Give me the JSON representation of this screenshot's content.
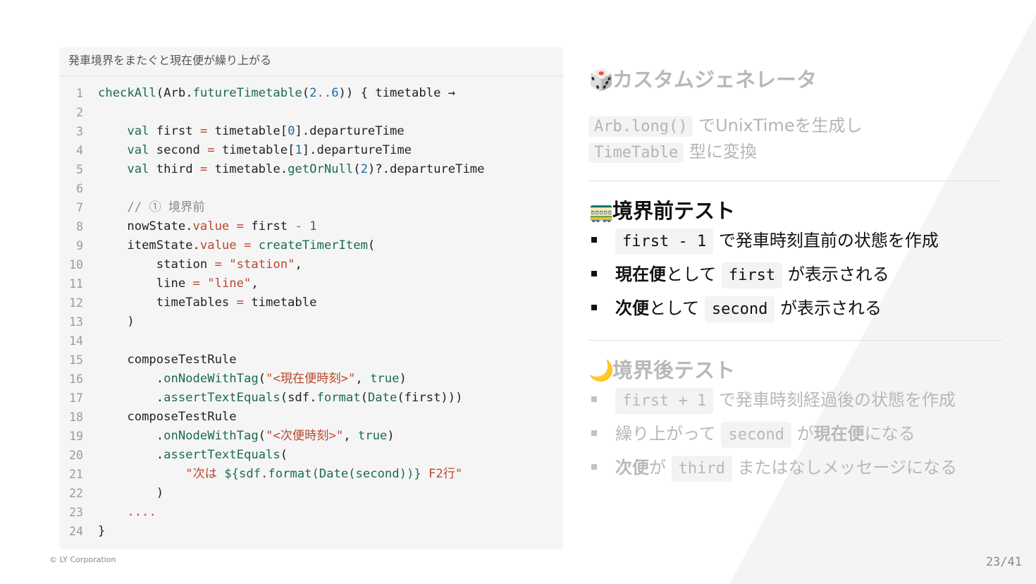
{
  "code_panel": {
    "title": "発車境界をまたぐと現在便が繰り上がる",
    "lines": [
      {
        "n": "1",
        "t": [
          [
            "fn",
            "checkAll"
          ],
          [
            "",
            "(Arb."
          ],
          [
            "fn",
            "futureTimetable"
          ],
          [
            "",
            "("
          ],
          [
            "num",
            "2"
          ],
          [
            "dot",
            ".."
          ],
          [
            "num",
            "6"
          ],
          [
            "",
            "))"
          ],
          [
            "",
            " { timetable →"
          ]
        ]
      },
      {
        "n": "2",
        "t": []
      },
      {
        "n": "3",
        "t": [
          [
            "",
            "    "
          ],
          [
            "kw",
            "val"
          ],
          [
            "",
            " first "
          ],
          [
            "op",
            "="
          ],
          [
            "",
            " timetable["
          ],
          [
            "num",
            "0"
          ],
          [
            "",
            "].departureTime"
          ]
        ]
      },
      {
        "n": "4",
        "t": [
          [
            "",
            "    "
          ],
          [
            "kw",
            "val"
          ],
          [
            "",
            " second "
          ],
          [
            "op",
            "="
          ],
          [
            "",
            " timetable["
          ],
          [
            "num",
            "1"
          ],
          [
            "",
            "].departureTime"
          ]
        ]
      },
      {
        "n": "5",
        "t": [
          [
            "",
            "    "
          ],
          [
            "kw",
            "val"
          ],
          [
            "",
            " third "
          ],
          [
            "op",
            "="
          ],
          [
            "",
            " timetable."
          ],
          [
            "fn",
            "getOrNull"
          ],
          [
            "",
            "("
          ],
          [
            "num",
            "2"
          ],
          [
            "",
            ")?.departureTime"
          ]
        ]
      },
      {
        "n": "6",
        "t": []
      },
      {
        "n": "7",
        "t": [
          [
            "",
            "    "
          ],
          [
            "cm",
            "// ① 境界前"
          ]
        ]
      },
      {
        "n": "8",
        "t": [
          [
            "",
            "    nowState."
          ],
          [
            "prop",
            "value"
          ],
          [
            "",
            " "
          ],
          [
            "op",
            "="
          ],
          [
            "",
            " first "
          ],
          [
            "op",
            "-"
          ],
          [
            "",
            " "
          ],
          [
            "num",
            "1"
          ]
        ]
      },
      {
        "n": "9",
        "t": [
          [
            "",
            "    itemState."
          ],
          [
            "prop",
            "value"
          ],
          [
            "",
            " "
          ],
          [
            "op",
            "="
          ],
          [
            "",
            " "
          ],
          [
            "fn",
            "createTimerItem"
          ],
          [
            "",
            "("
          ]
        ]
      },
      {
        "n": "10",
        "t": [
          [
            "",
            "        station "
          ],
          [
            "op",
            "="
          ],
          [
            "",
            " "
          ],
          [
            "str",
            "\"station\""
          ],
          [
            "",
            ","
          ]
        ]
      },
      {
        "n": "11",
        "t": [
          [
            "",
            "        line "
          ],
          [
            "op",
            "="
          ],
          [
            "",
            " "
          ],
          [
            "str",
            "\"line\""
          ],
          [
            "",
            ","
          ]
        ]
      },
      {
        "n": "12",
        "t": [
          [
            "",
            "        timeTables "
          ],
          [
            "op",
            "="
          ],
          [
            "",
            " timetable"
          ]
        ]
      },
      {
        "n": "13",
        "t": [
          [
            "",
            "    )"
          ]
        ]
      },
      {
        "n": "14",
        "t": []
      },
      {
        "n": "15",
        "t": [
          [
            "",
            "    composeTestRule"
          ]
        ]
      },
      {
        "n": "16",
        "t": [
          [
            "",
            "        ."
          ],
          [
            "fn",
            "onNodeWithTag"
          ],
          [
            "",
            "("
          ],
          [
            "str",
            "\"<現在便時刻>\""
          ],
          [
            "",
            ", "
          ],
          [
            "kw",
            "true"
          ],
          [
            "",
            ")"
          ]
        ]
      },
      {
        "n": "17",
        "t": [
          [
            "",
            "        ."
          ],
          [
            "fn",
            "assertTextEquals"
          ],
          [
            "",
            "(sdf."
          ],
          [
            "fn",
            "format"
          ],
          [
            "",
            "("
          ],
          [
            "fn",
            "Date"
          ],
          [
            "",
            "(first)))"
          ]
        ]
      },
      {
        "n": "18",
        "t": [
          [
            "",
            "    composeTestRule"
          ]
        ]
      },
      {
        "n": "19",
        "t": [
          [
            "",
            "        ."
          ],
          [
            "fn",
            "onNodeWithTag"
          ],
          [
            "",
            "("
          ],
          [
            "str",
            "\"<次便時刻>\""
          ],
          [
            "",
            ", "
          ],
          [
            "kw",
            "true"
          ],
          [
            "",
            ")"
          ]
        ]
      },
      {
        "n": "20",
        "t": [
          [
            "",
            "        ."
          ],
          [
            "fn",
            "assertTextEquals"
          ],
          [
            "",
            "("
          ]
        ]
      },
      {
        "n": "21",
        "t": [
          [
            "",
            "            "
          ],
          [
            "str",
            "\"次は "
          ],
          [
            "kw",
            "${"
          ],
          [
            "fn",
            "sdf.format(Date(second))"
          ],
          [
            "kw",
            "}"
          ],
          [
            "str",
            " F2行\""
          ]
        ]
      },
      {
        "n": "22",
        "t": [
          [
            "",
            "        )"
          ]
        ]
      },
      {
        "n": "23",
        "t": [
          [
            "",
            "    "
          ],
          [
            "op",
            "...."
          ]
        ]
      },
      {
        "n": "24",
        "t": [
          [
            "",
            "}"
          ]
        ]
      }
    ]
  },
  "section1": {
    "emoji": "🎲",
    "title": "カスタムジェネレータ",
    "line1_code": "Arb.long()",
    "line1_text": "でUnixTimeを生成し",
    "line2_code": "TimeTable",
    "line2_text": "型に変換"
  },
  "section2": {
    "emoji": "🚃",
    "title": "境界前テスト",
    "b1_code": "first - 1",
    "b1_text": "で発車時刻直前の状態を作成",
    "b2_bold": "現在便",
    "b2_mid": "として",
    "b2_code": "first",
    "b2_end": "が表示される",
    "b3_bold": "次便",
    "b3_mid": "として",
    "b3_code": "second",
    "b3_end": "が表示される"
  },
  "section3": {
    "emoji": "🌙",
    "title": "境界後テスト",
    "b1_code": "first + 1",
    "b1_text": "で発車時刻経過後の状態を作成",
    "b2_pre": "繰り上がって",
    "b2_code": "second",
    "b2_mid": "が",
    "b2_bold": "現在便",
    "b2_end": "になる",
    "b3_bold": "次便",
    "b3_mid": "が",
    "b3_code": "third",
    "b3_end": "またはなしメッセージになる"
  },
  "footer": {
    "copyright": "© LY Corporation",
    "page": "23/41"
  },
  "colors": {
    "code_bg": "#f5f5f5",
    "function": "#1c6b4a",
    "string": "#b8482e",
    "number": "#1a6aa6",
    "faded_text": "#b5b5b5"
  }
}
